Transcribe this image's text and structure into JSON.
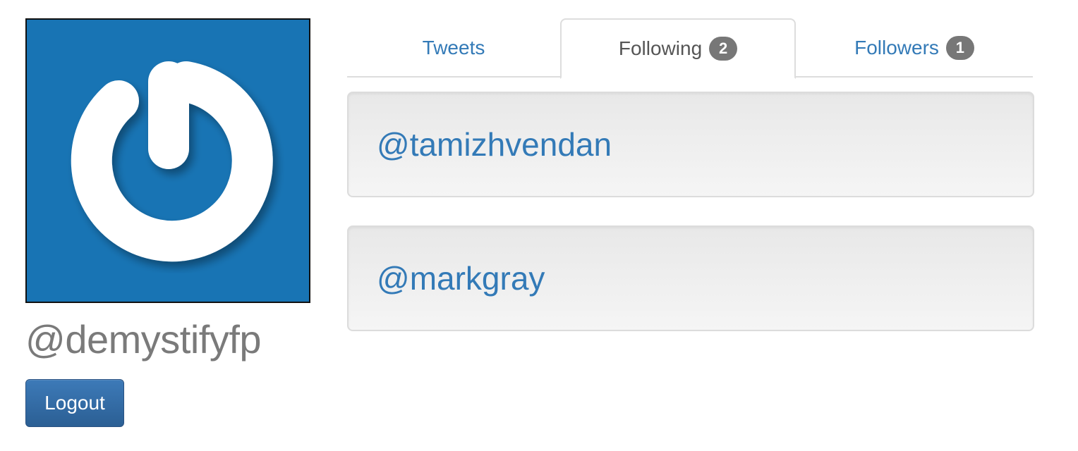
{
  "profile": {
    "avatar_icon": "power-button-icon",
    "handle": "@demystifyfp",
    "logout_label": "Logout"
  },
  "tabs": [
    {
      "label": "Tweets",
      "active": false
    },
    {
      "label": "Following",
      "badge": "2",
      "active": true
    },
    {
      "label": "Followers",
      "badge": "1",
      "active": false
    }
  ],
  "following": [
    {
      "handle": "@tamizhvendan"
    },
    {
      "handle": "@markgray"
    }
  ],
  "colors": {
    "avatar_background": "#1874b4",
    "link": "#337ab7",
    "badge": "#777777",
    "button": "#2e6399"
  }
}
